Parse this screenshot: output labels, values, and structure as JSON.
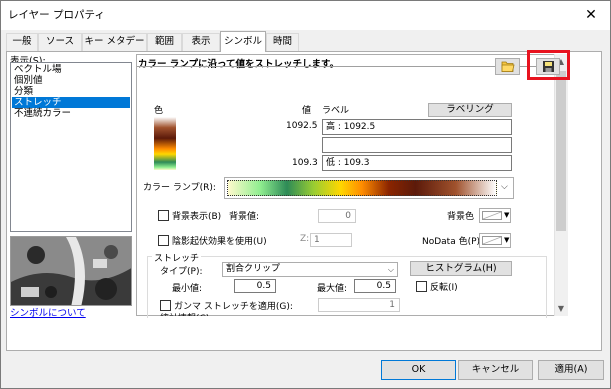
{
  "window": {
    "title": "レイヤー プロパティ",
    "close": "✕"
  },
  "tabs": [
    "一般",
    "ソース",
    "キー メタデータ",
    "範囲",
    "表示",
    "シンボル",
    "時間"
  ],
  "sidebar": {
    "label": "表示(S):",
    "items": [
      "ベクトル場",
      "個別値",
      "分類",
      "ストレッチ",
      "不連続カラー"
    ],
    "selected": "ストレッチ",
    "link": "シンボルについて"
  },
  "panel": {
    "heading": "カラー ランプに沿って値をストレッチします。",
    "color_header": "色",
    "value_header": "値",
    "label_header": "ラベル",
    "labeling_button": "ラベリング",
    "high_value": "1092.5",
    "high_label": "高 : 1092.5",
    "mid_label": "",
    "low_value": "109.3",
    "low_label": "低 : 109.3",
    "color_ramp_label": "カラー ランプ(R):",
    "show_background_label": "背景表示(B)",
    "background_value_label": "背景値:",
    "background_value": "0",
    "background_color_label": "背景色",
    "hillshade_label": "陰影起伏効果を使用(U)",
    "z_label": "Z:",
    "z_value": "1",
    "nodata_label": "NoData 色(P):",
    "stretch_group": "ストレッチ",
    "type_label": "タイプ(P):",
    "type_value": "割合クリップ",
    "histogram_button": "ヒストグラム(H)",
    "min_label": "最小値:",
    "min_value": "0.5",
    "max_label": "最大値:",
    "max_value": "0.5",
    "invert_label": "反転(I)",
    "gamma_label": "ガンマ ストレッチを適用(G):",
    "gamma_value": "1",
    "stats_label": "統計情報(C)"
  },
  "colors": {
    "ramp": [
      "#fffacd",
      "#90ee90",
      "#2e8b57",
      "#9acd32",
      "#ffd700",
      "#ff8c00",
      "#8b2500",
      "#5c1a0a",
      "#a0522d",
      "#ffffff"
    ]
  },
  "footer": {
    "ok": "OK",
    "cancel": "キャンセル",
    "apply": "適用(A)"
  }
}
